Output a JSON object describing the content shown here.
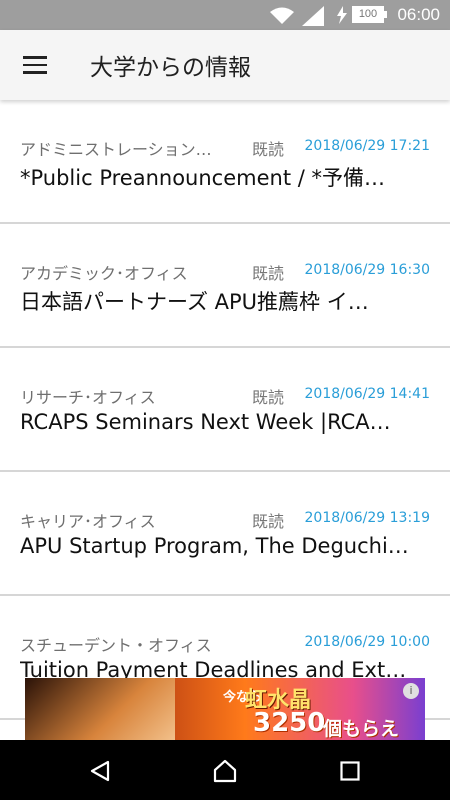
{
  "status_bar": {
    "time": "06:00",
    "battery": "100",
    "icons": [
      "wifi-icon",
      "signal-icon",
      "charging-icon",
      "battery-icon"
    ]
  },
  "app_bar": {
    "title": "大学からの情報",
    "menu_icon": "hamburger-menu-icon"
  },
  "items": [
    {
      "category": "アドミニストレーション…",
      "read_label": "既読",
      "date": "2018/06/29 17:21",
      "title": "*Public Preannouncement / *予備…"
    },
    {
      "category": "アカデミック･オフィス",
      "read_label": "既読",
      "date": "2018/06/29 16:30",
      "title": "日本語パートナーズ APU推薦枠 イ…"
    },
    {
      "category": "リサーチ･オフィス",
      "read_label": "既読",
      "date": "2018/06/29 14:41",
      "title": "RCAPS Seminars Next Week |RCA…"
    },
    {
      "category": "キャリア･オフィス",
      "read_label": "既読",
      "date": "2018/06/29 13:19",
      "title": "APU Startup Program, The Deguchi…"
    },
    {
      "category": "スチューデント・オフィス",
      "read_label": "",
      "date": "2018/06/29 10:00",
      "title": "Tuition Payment Deadlines and Ext…"
    }
  ],
  "ad_banner": {
    "prefix": "今なら",
    "line1": "虹水晶",
    "number": "3250",
    "suffix": "個もらえる!",
    "info_icon": "info-icon"
  },
  "nav_bar": {
    "icons": [
      "back-icon",
      "home-icon",
      "recents-icon"
    ]
  },
  "colors": {
    "accent_date": "#2a9ed8",
    "status_bar": "#9e9e9e",
    "app_bar": "#f5f5f5"
  }
}
